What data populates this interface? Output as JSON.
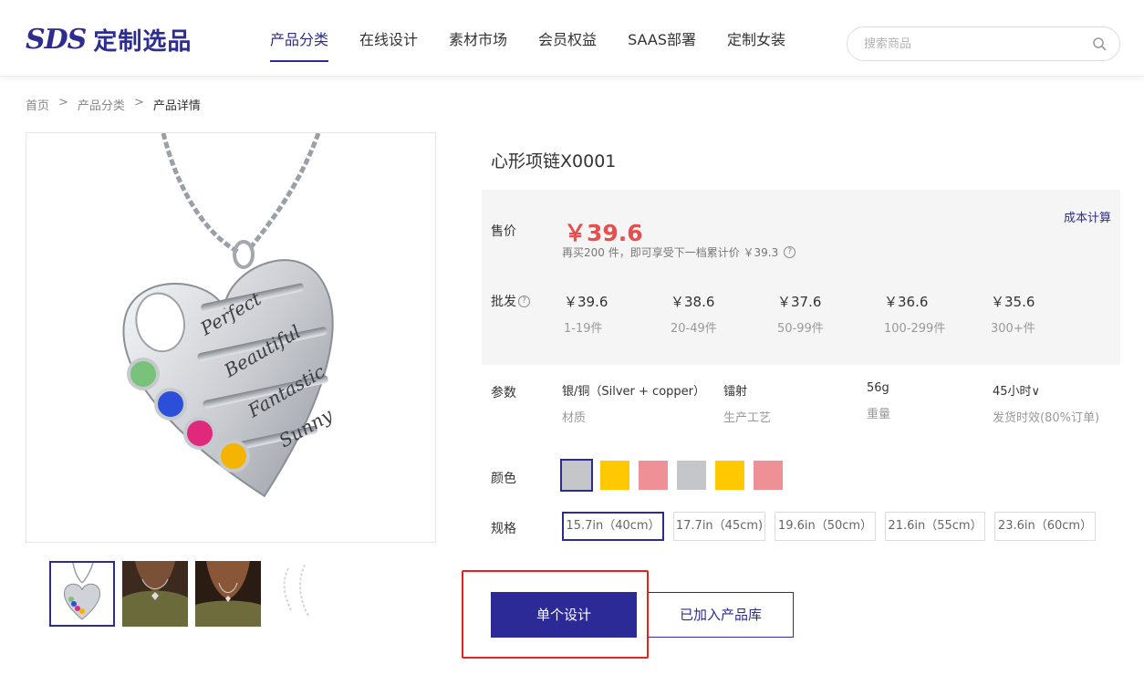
{
  "header": {
    "logo_mark": "SDS",
    "logo_text": "定制选品",
    "nav": [
      "产品分类",
      "在线设计",
      "素材市场",
      "会员权益",
      "SAAS部署",
      "定制女装"
    ],
    "search_placeholder": "搜索商品"
  },
  "breadcrumb": [
    "首页",
    ">",
    "产品分类",
    ">",
    "产品详情"
  ],
  "product": {
    "title": "心形项链X0001",
    "price_label": "售价",
    "price": "￥39.6",
    "price_note": "再买200 件，即可享受下一档累计价 ￥39.3",
    "cost_link": "成本计算",
    "wholesale_label": "批发",
    "tiers": [
      {
        "price": "￥39.6",
        "qty": "1-19件"
      },
      {
        "price": "￥38.6",
        "qty": "20-49件"
      },
      {
        "price": "￥37.6",
        "qty": "50-99件"
      },
      {
        "price": "￥36.6",
        "qty": "100-299件"
      },
      {
        "price": "￥35.6",
        "qty": "300+件"
      }
    ],
    "params_label": "参数",
    "params": [
      {
        "value": "银/铜（Silver + copper）",
        "label": "材质"
      },
      {
        "value": "镭射",
        "label": "生产工艺"
      },
      {
        "value": "56g",
        "label": "重量"
      },
      {
        "value": "45小时∨",
        "label": "发货时效(80%订单)"
      }
    ],
    "color_label": "颜色",
    "colors": [
      "#c4c6ca",
      "#ffc800",
      "#ef9096",
      "#c4c6ca",
      "#ffc800",
      "#ef9096"
    ],
    "spec_label": "规格",
    "specs": [
      "15.7in（40cm）",
      "17.7in（45cm)",
      "19.6in（50cm）",
      "21.6in（55cm）",
      "23.6in（60cm）"
    ],
    "engraved_names": [
      "Perfect",
      "Beautiful",
      "Fantastic",
      "Sunny"
    ]
  },
  "actions": {
    "design_button": "单个设计",
    "library_button": "已加入产品库"
  }
}
